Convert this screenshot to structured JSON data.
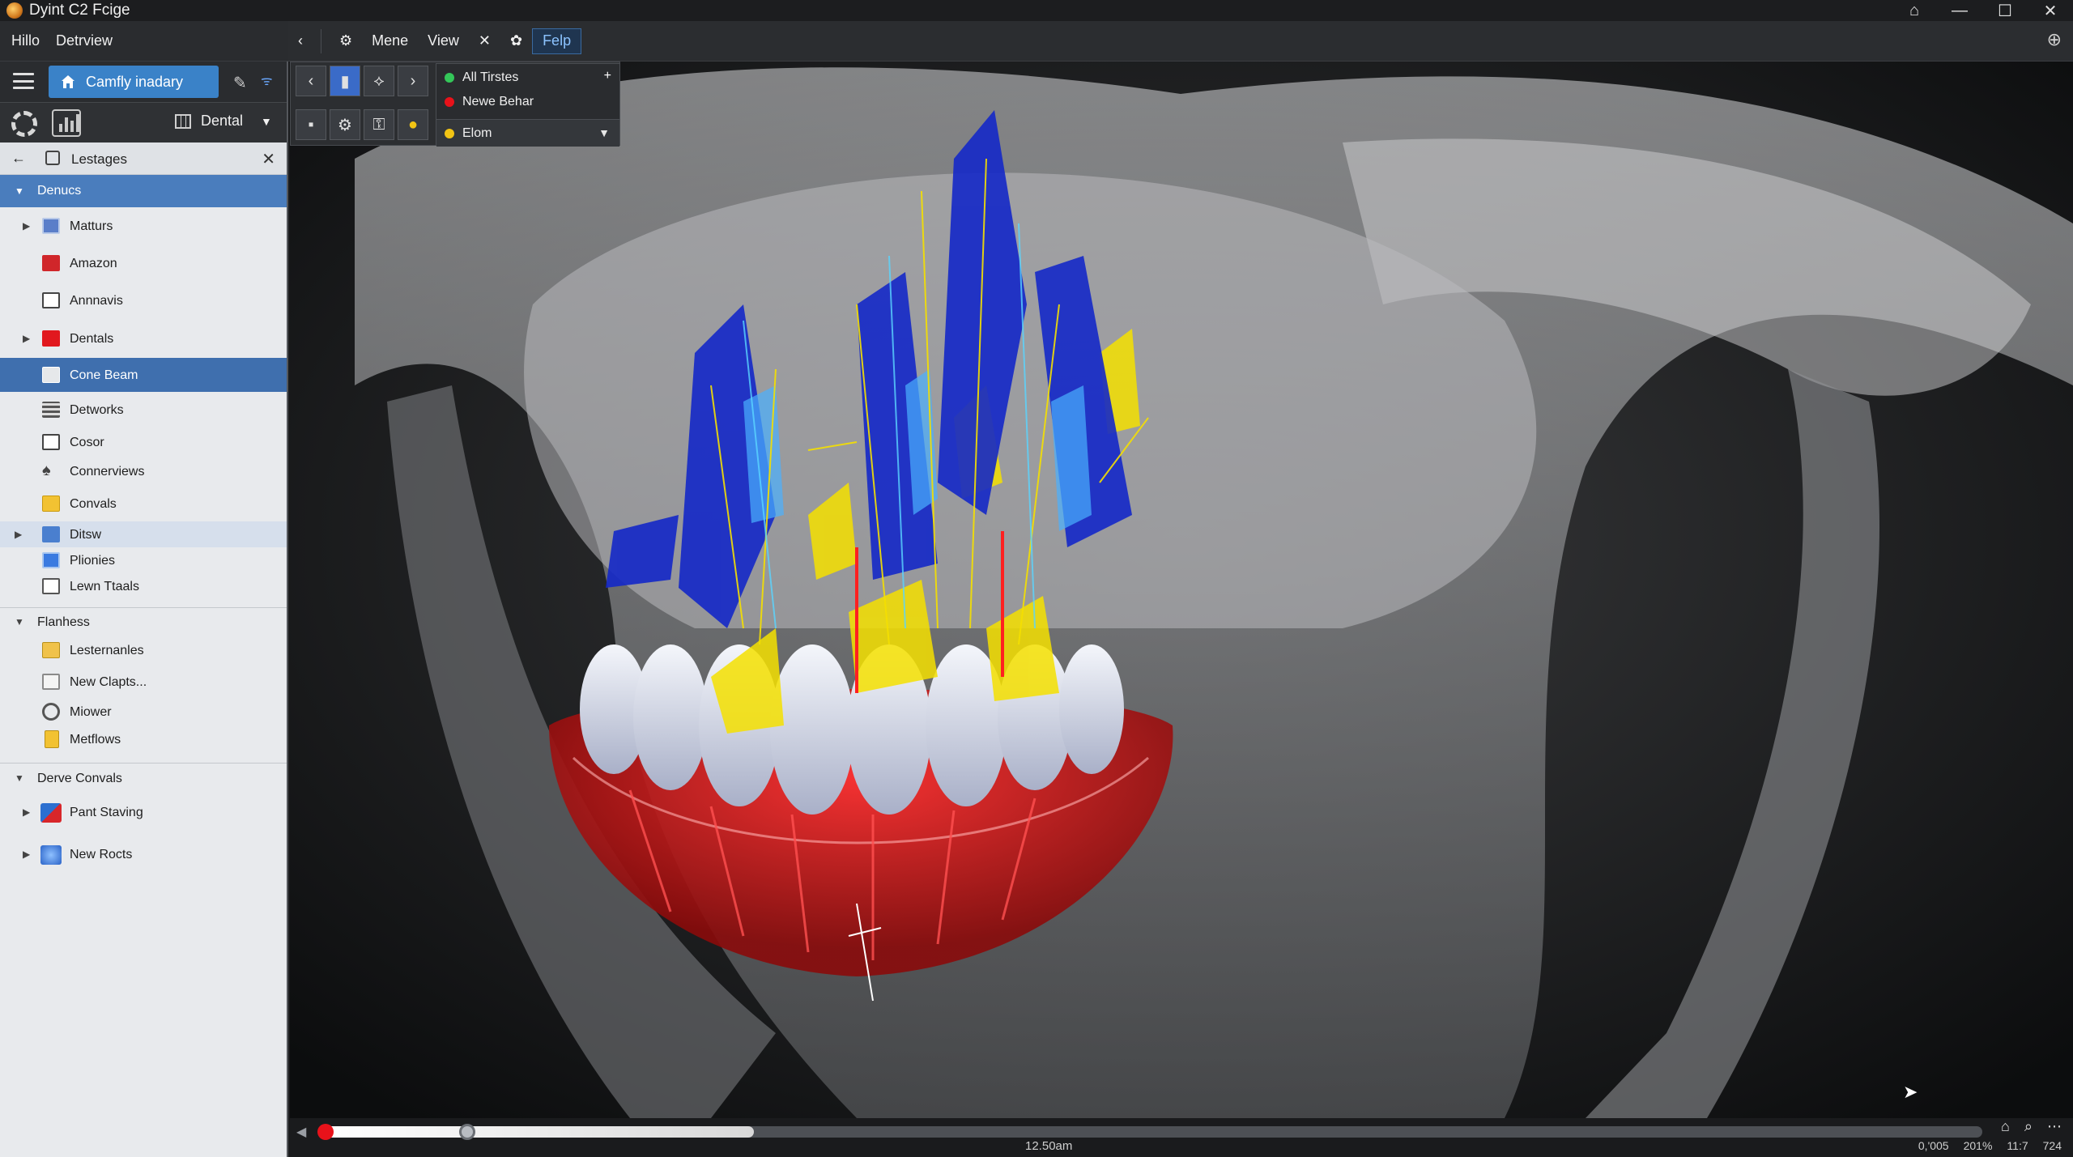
{
  "window": {
    "title": "Dyint C2 Fcige",
    "controls": [
      "home",
      "minimize",
      "maximize",
      "close"
    ]
  },
  "menubar": {
    "left": [
      "Hillo",
      "Detrview"
    ],
    "right": [
      "Mene",
      "View",
      "Felp"
    ],
    "active": "Felp"
  },
  "sidebar": {
    "home_tab_label": "Camfly inadary",
    "dropdown_label": "Dental",
    "breadcrumb_label": "Lestages",
    "tree": [
      {
        "label": "Denucs",
        "type": "section",
        "expanded": true
      },
      {
        "label": "Matturs",
        "icon": "blue-book-icon",
        "expandable": true
      },
      {
        "label": "Amazon",
        "icon": "red-box-icon"
      },
      {
        "label": "Annnavis",
        "icon": "window-icon"
      },
      {
        "label": "Dentals",
        "icon": "red-square-icon",
        "expandable": true
      },
      {
        "label": "Cone Beam",
        "icon": "document-icon",
        "selected": true
      },
      {
        "label": "Detworks",
        "icon": "grid-icon"
      },
      {
        "label": "Cosor",
        "icon": "window-icon"
      },
      {
        "label": "Connerviews",
        "icon": "tree-icon"
      },
      {
        "label": "Convals",
        "icon": "yellow-folder-icon"
      },
      {
        "label": "Ditsw",
        "icon": "blue-image-icon",
        "expandable": true,
        "highlighted": true
      },
      {
        "label": "Plionies",
        "icon": "blue-square-icon"
      },
      {
        "label": "Lewn Ttaals",
        "icon": "page-icon"
      },
      {
        "label": "Flanhess",
        "type": "section2",
        "expanded": true
      },
      {
        "label": "Lesternanles",
        "icon": "folder-icon"
      },
      {
        "label": "New Clapts...",
        "icon": "doc-list-icon"
      },
      {
        "label": "Miower",
        "icon": "gear-outline-icon"
      },
      {
        "label": "Metflows",
        "icon": "yellow-doc-icon"
      },
      {
        "label": "Derve Convals",
        "type": "section2",
        "expanded": true
      },
      {
        "label": "Pant Staving",
        "icon": "chart-icon",
        "expandable": true
      },
      {
        "label": "New Rocts",
        "icon": "globe-icon",
        "expandable": true
      }
    ]
  },
  "viewport_menu": {
    "options": [
      {
        "label": "All Tirstes",
        "color": "#34c759"
      },
      {
        "label": "Newe Behar",
        "color": "#e8121a"
      }
    ],
    "selected": "Elom",
    "selected_color": "#f2c414"
  },
  "timeline": {
    "progress": 0.26,
    "time_label": "12.50am",
    "stats": [
      "0,'005",
      "201%",
      "11:7",
      "724"
    ]
  },
  "colors": {
    "accent": "#3a82c8",
    "selection": "#3f6fae",
    "nerve_blue": "#1428c8",
    "highlight_yellow": "#f5e000",
    "gum_red": "#e8121a"
  }
}
